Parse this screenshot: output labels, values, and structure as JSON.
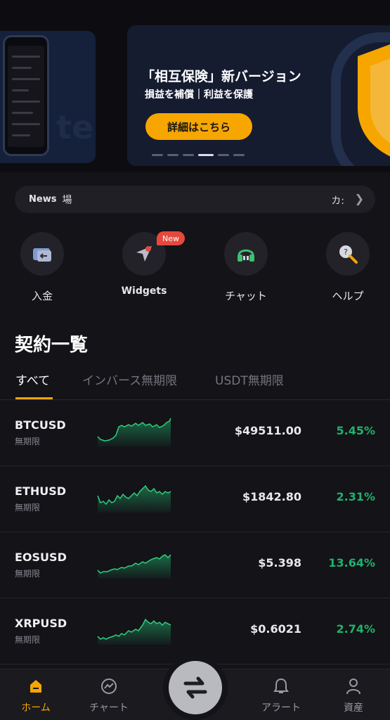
{
  "banner": {
    "title": "「相互保険」新バージョン",
    "subtitle": "損益を補償｜利益を保護",
    "cta_label": "詳細はこちら",
    "side_text": "te",
    "accent": "#f7a600"
  },
  "news": {
    "label": "News",
    "text": "場",
    "right_text": "カ:"
  },
  "quick_actions": [
    {
      "label": "入金",
      "icon": "deposit-wallet-icon"
    },
    {
      "label": "Widgets",
      "icon": "widgets-pointer-icon",
      "badge": "New"
    },
    {
      "label": "チャット",
      "icon": "headset-icon"
    },
    {
      "label": "ヘルプ",
      "icon": "help-magnifier-icon"
    }
  ],
  "contracts": {
    "title": "契約一覧",
    "tabs": [
      "すべて",
      "インバース無期限",
      "USDT無期限"
    ],
    "rows": [
      {
        "symbol": "BTCUSD",
        "type": "無期限",
        "price": "$49511.00",
        "change": "5.45%"
      },
      {
        "symbol": "ETHUSD",
        "type": "無期限",
        "price": "$1842.80",
        "change": "2.31%"
      },
      {
        "symbol": "EOSUSD",
        "type": "無期限",
        "price": "$5.398",
        "change": "13.64%"
      },
      {
        "symbol": "XRPUSD",
        "type": "無期限",
        "price": "$0.6021",
        "change": "2.74%"
      }
    ],
    "up_color": "#20b26c"
  },
  "nav": {
    "home": "ホーム",
    "chart": "チャート",
    "alert": "アラート",
    "assets": "資産",
    "active_color": "#f7a600"
  }
}
